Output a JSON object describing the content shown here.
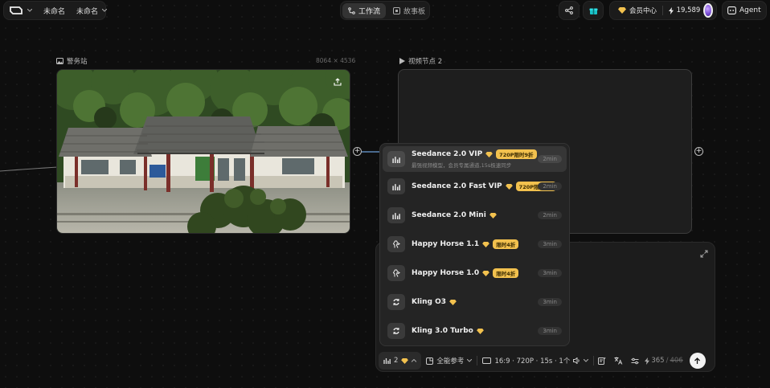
{
  "topbar": {
    "project_name": "未命名",
    "workspace_name": "未命名",
    "tabs": [
      {
        "label": "工作流",
        "active": true
      },
      {
        "label": "故事板",
        "active": false
      }
    ],
    "member_label": "会员中心",
    "credits": "19,589",
    "agent_label": "Agent"
  },
  "image_node": {
    "title": "警务站",
    "resolution": "8064 × 4536"
  },
  "video_node": {
    "title": "视频节点 2"
  },
  "model_menu": {
    "items": [
      {
        "name": "Seedance 2.0 VIP",
        "badge": "720P限时9折",
        "desc": "最强视频模型，会员专属通道,15s极速同步",
        "duration": "2min",
        "icon": "bar-chart-icon"
      },
      {
        "name": "Seedance 2.0 Fast VIP",
        "badge": "720P限时9折",
        "desc": "",
        "duration": "2min",
        "icon": "bar-chart-icon"
      },
      {
        "name": "Seedance 2.0 Mini",
        "badge": "",
        "desc": "",
        "duration": "2min",
        "icon": "bar-chart-icon"
      },
      {
        "name": "Happy Horse 1.1",
        "badge": "限时4折",
        "desc": "",
        "duration": "3min",
        "icon": "horse-icon"
      },
      {
        "name": "Happy Horse 1.0",
        "badge": "限时4折",
        "desc": "",
        "duration": "3min",
        "icon": "horse-icon"
      },
      {
        "name": "Kling O3",
        "badge": "",
        "desc": "",
        "duration": "3min",
        "icon": "kling-icon"
      },
      {
        "name": "Kling 3.0 Turbo",
        "badge": "",
        "desc": "",
        "duration": "3min",
        "icon": "kling-icon"
      }
    ]
  },
  "bottom_bar": {
    "model_count": "2",
    "reference_mode": "全能参考",
    "settings": "16:9 · 720P · 15s · 1个",
    "cost": "365",
    "cost_original": "406"
  },
  "colors": {
    "accent_gold": "#f2c14e",
    "background": "#0e0e0e",
    "panel": "#1c1c1c"
  }
}
